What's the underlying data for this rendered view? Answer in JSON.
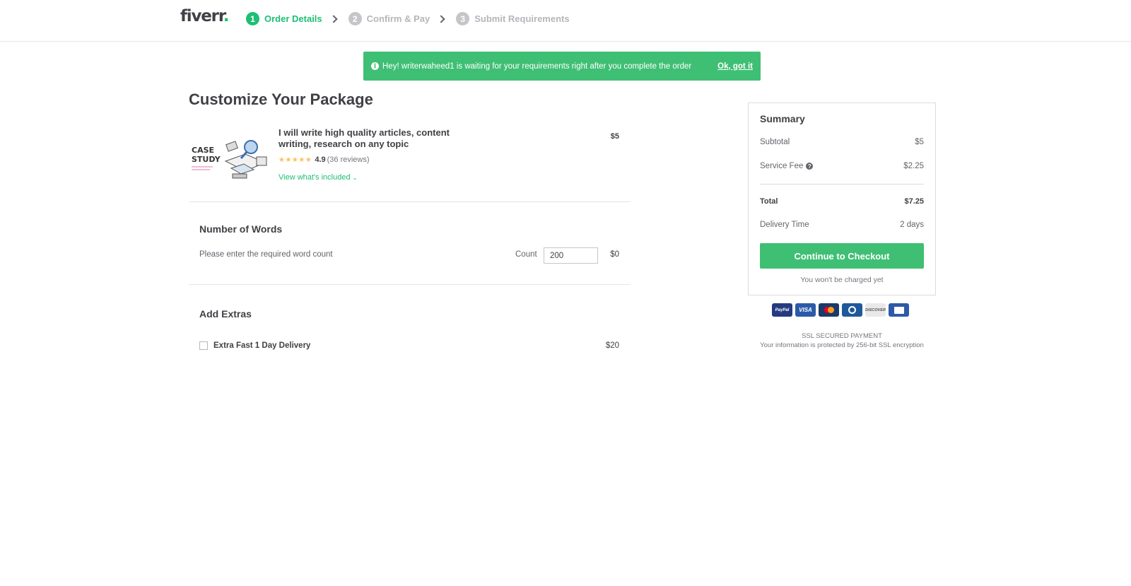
{
  "header": {
    "logo_text": "fiverr",
    "logo_dot": ".",
    "steps": [
      {
        "num": "1",
        "label": "Order Details",
        "active": true
      },
      {
        "num": "2",
        "label": "Confirm & Pay",
        "active": false
      },
      {
        "num": "3",
        "label": "Submit Requirements",
        "active": false
      }
    ]
  },
  "banner": {
    "message": "Hey! writerwaheed1 is waiting for your requirements right after you complete the order",
    "ok_label": "Ok, got it",
    "info_icon": "info-icon"
  },
  "page": {
    "title": "Customize Your Package"
  },
  "gig": {
    "thumb_text_1": "CASE",
    "thumb_text_2": "STUDY",
    "title": "I will write high quality articles, content writing, research on any topic",
    "stars": "★★★★★",
    "rating": "4.9",
    "reviews": "(36 reviews)",
    "view_included": "View what's included",
    "price": "$5"
  },
  "words": {
    "title": "Number of Words",
    "description": "Please enter the required word count",
    "count_label": "Count",
    "count_value": "200",
    "price": "$0"
  },
  "extras": {
    "title": "Add Extras",
    "items": [
      {
        "label": "Extra Fast 1 Day Delivery",
        "price": "$20",
        "checked": false
      }
    ]
  },
  "summary": {
    "title": "Summary",
    "subtotal_label": "Subtotal",
    "subtotal_value": "$5",
    "service_fee_label": "Service Fee",
    "service_fee_value": "$2.25",
    "total_label": "Total",
    "total_value": "$7.25",
    "delivery_label": "Delivery Time",
    "delivery_value": "2 days",
    "checkout_label": "Continue to Checkout",
    "not_charged": "You won't be charged yet"
  },
  "payments": {
    "paypal": "PayPal",
    "visa": "VISA",
    "discover": "DISCOVER"
  },
  "ssl": {
    "title": "SSL SECURED PAYMENT",
    "subtitle": "Your information is protected by 256-bit SSL encryption"
  },
  "colors": {
    "brand_green": "#1dbf73",
    "banner_green": "#3fbf74",
    "text_dark": "#404145",
    "star_yellow": "#ffbe5b"
  }
}
